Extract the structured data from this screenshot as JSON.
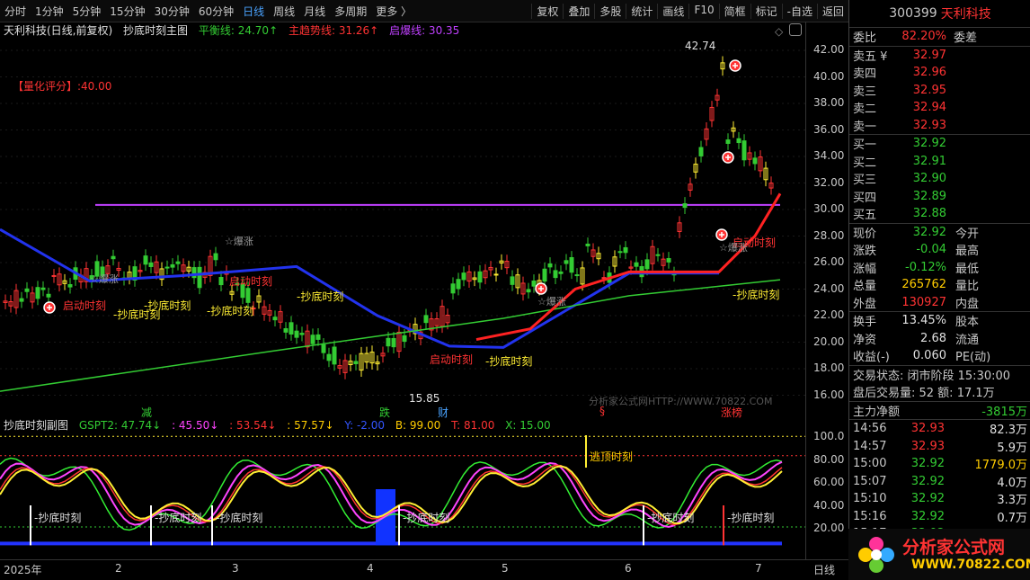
{
  "toolbar": {
    "tabs": [
      "分时",
      "1分钟",
      "5分钟",
      "15分钟",
      "30分钟",
      "60分钟",
      "日线",
      "周线",
      "月线",
      "多周期",
      "更多 〉"
    ],
    "active": "日线",
    "right_tabs": [
      "复权",
      "叠加",
      "多股",
      "统计",
      "画线",
      "F10",
      "简框",
      "标记",
      "-自选",
      "返回"
    ]
  },
  "main": {
    "stock_title": "天利科技(日线,前复权)",
    "indicator_name": "抄底时刻主图",
    "lines": {
      "balance": "平衡线: 24.70↑",
      "trend": "主趋势线: 31.26↑",
      "start": "启爆线: 30.35"
    },
    "score": "【量化评分】:40.00",
    "high_label": "42.74",
    "low_label": "15.85",
    "watermark": "分析家公式网HTTP://WWW.70822.COM",
    "y_ticks": [
      "42.00",
      "40.00",
      "38.00",
      "36.00",
      "34.00",
      "32.00",
      "30.00",
      "28.00",
      "26.00",
      "24.00",
      "22.00",
      "20.00",
      "18.00",
      "16.00"
    ],
    "annot_buy": "抄底时刻",
    "annot_start": "启动时刻",
    "annot_explode": "爆涨",
    "bottom_marks": [
      "减",
      "跌",
      "财",
      "§",
      "涨榜"
    ]
  },
  "sub": {
    "name": "抄底时刻副图",
    "params": [
      "GSPT2: 47.74↓",
      ": 45.50↓",
      ": 53.54↓",
      ": 57.57↓",
      "Y: -2.00",
      "B: 99.00",
      "T: 81.00",
      "X: 15.00"
    ],
    "y_ticks": [
      "100.0",
      "80.00",
      "60.00",
      "40.00",
      "20.00"
    ],
    "annot_top": "逃顶时刻",
    "annot_buy": "抄底时刻"
  },
  "xaxis": {
    "labels": [
      "2025年",
      "2",
      "3",
      "4",
      "5",
      "6",
      "7"
    ],
    "period": "日线"
  },
  "quote": {
    "code": "300399",
    "name": "天利科技",
    "weibi_label": "委比",
    "weibi": "82.20%",
    "weicha_label": "委差",
    "asks": [
      {
        "l": "卖五 ¥",
        "p": "32.97"
      },
      {
        "l": "卖四",
        "p": "32.96"
      },
      {
        "l": "卖三",
        "p": "32.95"
      },
      {
        "l": "卖二",
        "p": "32.94"
      },
      {
        "l": "卖一",
        "p": "32.93"
      }
    ],
    "bids": [
      {
        "l": "买一",
        "p": "32.92"
      },
      {
        "l": "买二",
        "p": "32.91"
      },
      {
        "l": "买三",
        "p": "32.90"
      },
      {
        "l": "买四",
        "p": "32.89"
      },
      {
        "l": "买五",
        "p": "32.88"
      }
    ],
    "stats": [
      {
        "l": "现价",
        "v": "32.92",
        "l2": "今开"
      },
      {
        "l": "涨跌",
        "v": "-0.04",
        "l2": "最高"
      },
      {
        "l": "涨幅",
        "v": "-0.12%",
        "l2": "最低"
      },
      {
        "l": "总量",
        "v": "265762",
        "l2": "量比"
      },
      {
        "l": "外盘",
        "v": "130927",
        "l2": "内盘"
      }
    ],
    "stats2": [
      {
        "l": "换手",
        "v": "13.45%",
        "l2": "股本"
      },
      {
        "l": "净资",
        "v": "2.68",
        "l2": "流通"
      },
      {
        "l": "收益(-)",
        "v": "0.060",
        "l2": "PE(动)"
      }
    ],
    "trade_state": "交易状态: 闭市阶段 15:30:00",
    "after_hours": "盘后交易量: 52  额: 17.1万",
    "main_net_label": "主力净额",
    "main_net": "-3815万",
    "ticks": [
      {
        "t": "14:56",
        "p": "32.93",
        "v": "82.3万"
      },
      {
        "t": "14:57",
        "p": "32.93",
        "v": "5.9万"
      },
      {
        "t": "15:00",
        "p": "32.92",
        "v": "1779.0万"
      },
      {
        "t": "15:07",
        "p": "32.92",
        "v": "4.0万"
      },
      {
        "t": "15:10",
        "p": "32.92",
        "v": "3.3万"
      },
      {
        "t": "15:16",
        "p": "32.92",
        "v": "0.7万"
      },
      {
        "t": "15:17",
        "p": "32.92",
        "v": "1.3万"
      }
    ],
    "logo_text": "分析家公式网",
    "logo_url": "WWW.70822.COM"
  }
}
